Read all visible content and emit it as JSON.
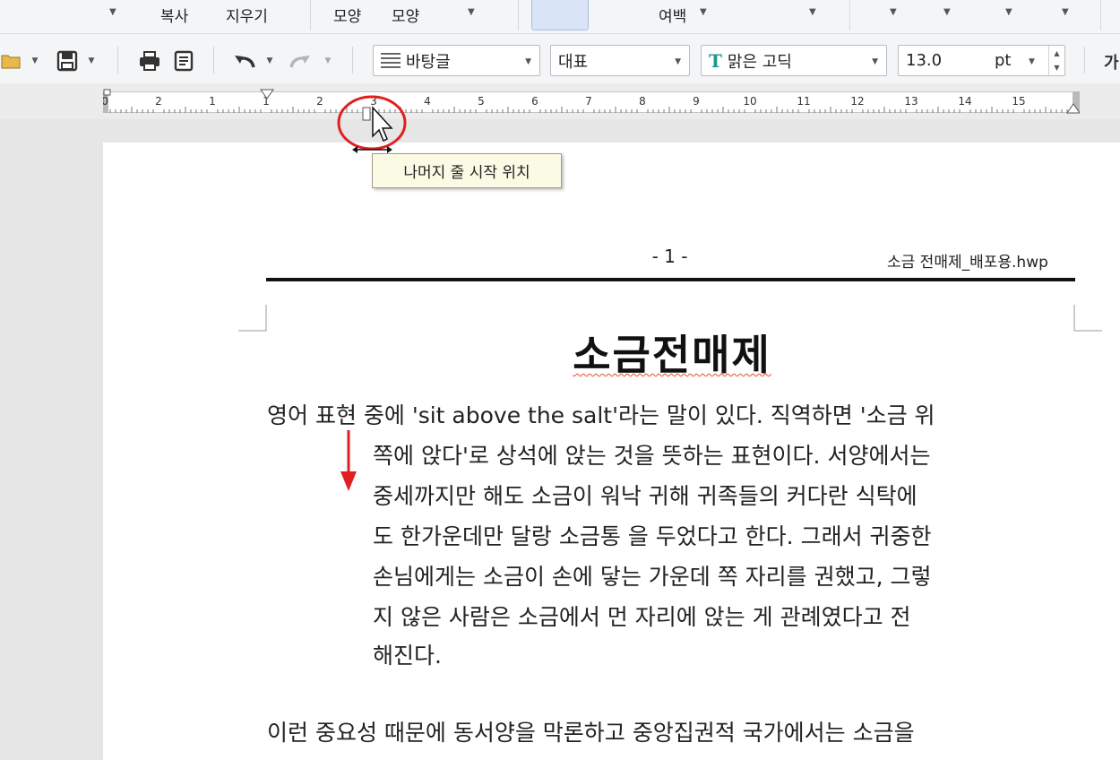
{
  "top_strip": {
    "items": [
      "복사",
      "지우기",
      "모양",
      "모양",
      "여백"
    ]
  },
  "toolbar": {
    "style_combo": "바탕글",
    "lang_combo": "대표",
    "font_combo": "맑은 고딕",
    "size_value": "13.0",
    "size_unit": "pt",
    "cut_label": "가"
  },
  "ruler": {
    "labels": [
      "0",
      "2",
      "1",
      "1",
      "2",
      "3",
      "4",
      "5",
      "6",
      "7",
      "8",
      "9",
      "10",
      "11",
      "12",
      "13",
      "14",
      "15"
    ]
  },
  "tooltip": {
    "text": "나머지 줄 시작 위치"
  },
  "header": {
    "page_number": "- 1 -",
    "file_name": "소금 전매제_배포용.hwp"
  },
  "document": {
    "title": "소금전매제",
    "lines": [
      "영어 표현 중에 'sit above the salt'라는 말이 있다. 직역하면 '소금 위",
      "쪽에 앉다'로 상석에 앉는 것을 뜻하는 표현이다. 서양에서는",
      "중세까지만 해도 소금이 워낙 귀해 귀족들의 커다란 식탁에",
      "도 한가운데만 달랑 소금통 을 두었다고 한다. 그래서 귀중한",
      "손님에게는 소금이 손에 닿는 가운데 쪽 자리를 권했고, 그렇",
      "지 않은 사람은 소금에서 먼 자리에 앉는 게 관례였다고 전",
      "해진다.",
      "이런 중요성 때문에 동서양을 막론하고 중앙집권적 국가에서는 소금을"
    ]
  },
  "colors": {
    "highlight_circle": "#e02020",
    "arrow": "#e02020",
    "spell_underline": "#e24a2a"
  }
}
